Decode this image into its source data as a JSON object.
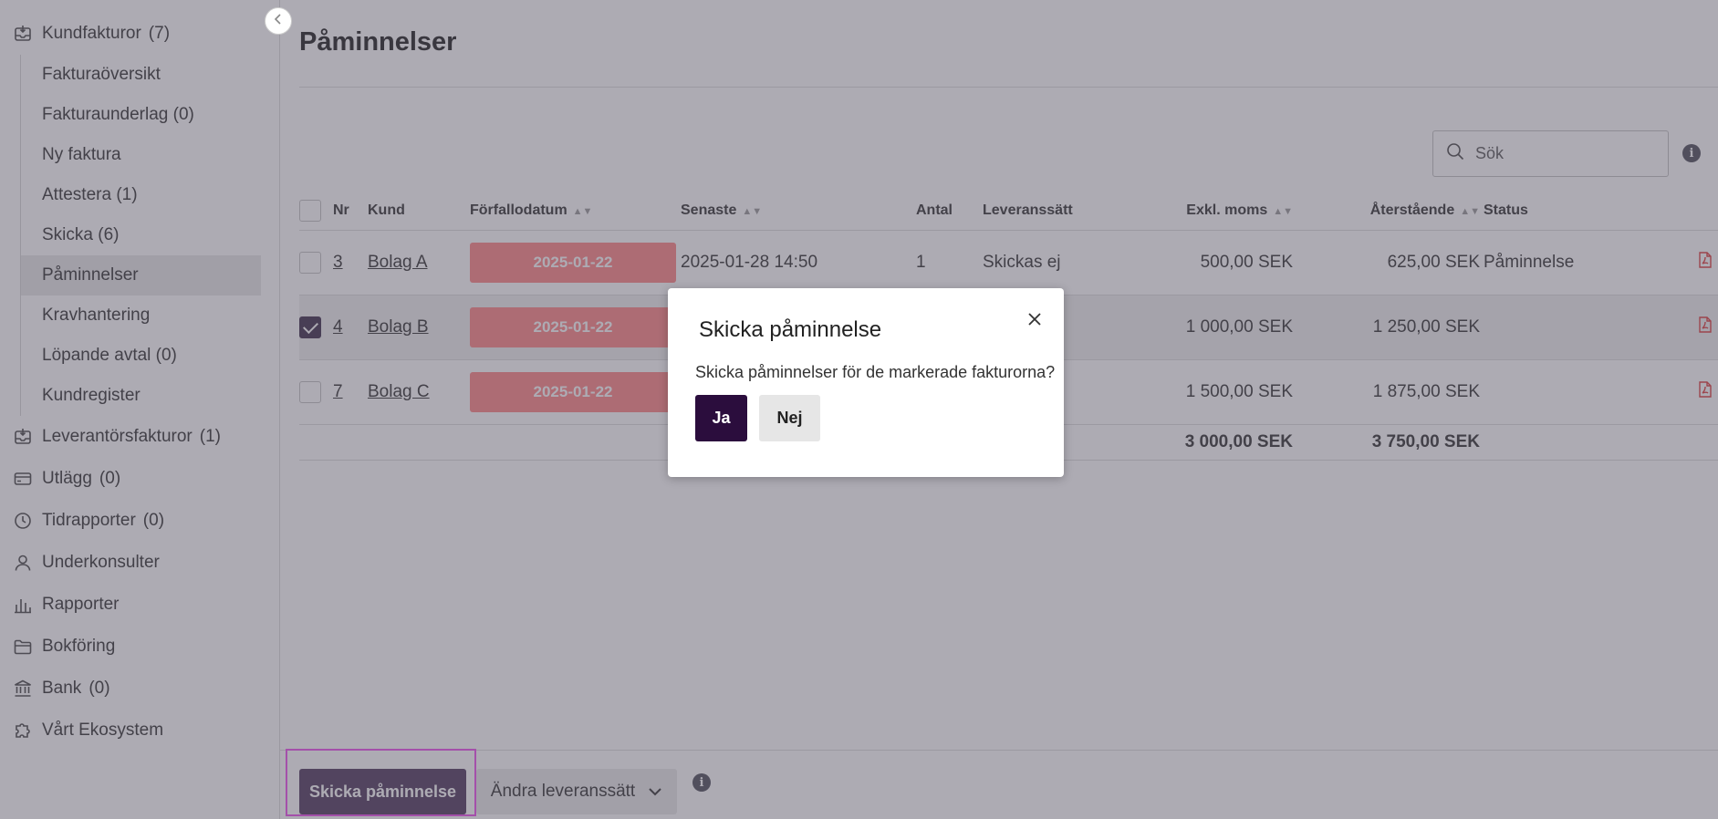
{
  "sidebar": {
    "customer_invoices": {
      "label": "Kundfakturor",
      "count": "(7)",
      "icon": "inbox-icon"
    },
    "sub_items": [
      {
        "label": "Fakturaöversikt"
      },
      {
        "label": "Fakturaunderlag (0)"
      },
      {
        "label": "Ny faktura"
      },
      {
        "label": "Attestera (1)"
      },
      {
        "label": "Skicka (6)"
      },
      {
        "label": "Påminnelser",
        "active": true
      },
      {
        "label": "Kravhantering"
      },
      {
        "label": "Löpande avtal (0)"
      },
      {
        "label": "Kundregister"
      }
    ],
    "items": [
      {
        "label": "Leverantörsfakturor",
        "count": "(1)",
        "icon": "inbox-icon"
      },
      {
        "label": "Utlägg",
        "count": "(0)",
        "icon": "card-icon"
      },
      {
        "label": "Tidrapporter",
        "count": "(0)",
        "icon": "clock-icon"
      },
      {
        "label": "Underkonsulter",
        "count": "",
        "icon": "user-icon"
      },
      {
        "label": "Rapporter",
        "count": "",
        "icon": "bar-chart-icon"
      },
      {
        "label": "Bokföring",
        "count": "",
        "icon": "folder-icon"
      },
      {
        "label": "Bank",
        "count": "(0)",
        "icon": "bank-icon"
      },
      {
        "label": "Vårt Ekosystem",
        "count": "",
        "icon": "puzzle-icon"
      }
    ]
  },
  "main": {
    "title": "Påminnelser",
    "search": {
      "placeholder": "Sök"
    },
    "table": {
      "headers": {
        "nr": "Nr",
        "kund": "Kund",
        "due": "Förfallodatum",
        "latest": "Senaste",
        "antal": "Antal",
        "delivery": "Leveranssätt",
        "excl_vat": "Exkl. moms",
        "remaining": "Återstående",
        "status": "Status"
      },
      "rows": [
        {
          "checked": false,
          "nr": "3",
          "kund": "Bolag A",
          "due": "2025-01-22",
          "latest": "2025-01-28 14:50",
          "antal": "1",
          "delivery": "Skickas ej",
          "excl_vat": "500,00 SEK",
          "remaining": "625,00 SEK",
          "status": "Påminnelse"
        },
        {
          "checked": true,
          "nr": "4",
          "kund": "Bolag B",
          "due": "2025-01-22",
          "latest": "",
          "antal": "",
          "delivery": "",
          "excl_vat": "1 000,00 SEK",
          "remaining": "1 250,00 SEK",
          "status": ""
        },
        {
          "checked": false,
          "nr": "7",
          "kund": "Bolag C",
          "due": "2025-01-22",
          "latest": "",
          "antal": "",
          "delivery": "",
          "excl_vat": "1 500,00 SEK",
          "remaining": "1 875,00 SEK",
          "status": ""
        }
      ],
      "totals": {
        "excl_vat": "3 000,00 SEK",
        "remaining": "3 750,00 SEK"
      }
    }
  },
  "footer": {
    "send_label": "Skicka påminnelse",
    "delivery_label": "Ändra leveranssätt"
  },
  "modal": {
    "title": "Skicka påminnelse",
    "text": "Skicka påminnelser för de markerade fakturorna?",
    "yes_label": "Ja",
    "no_label": "Nej"
  },
  "colors": {
    "due_badge": "#ff9a9a",
    "primary": "#2b0d3d",
    "send_button": "#6c5a78",
    "highlight": "#f06cf0",
    "pdf_icon": "#e45b5b"
  }
}
